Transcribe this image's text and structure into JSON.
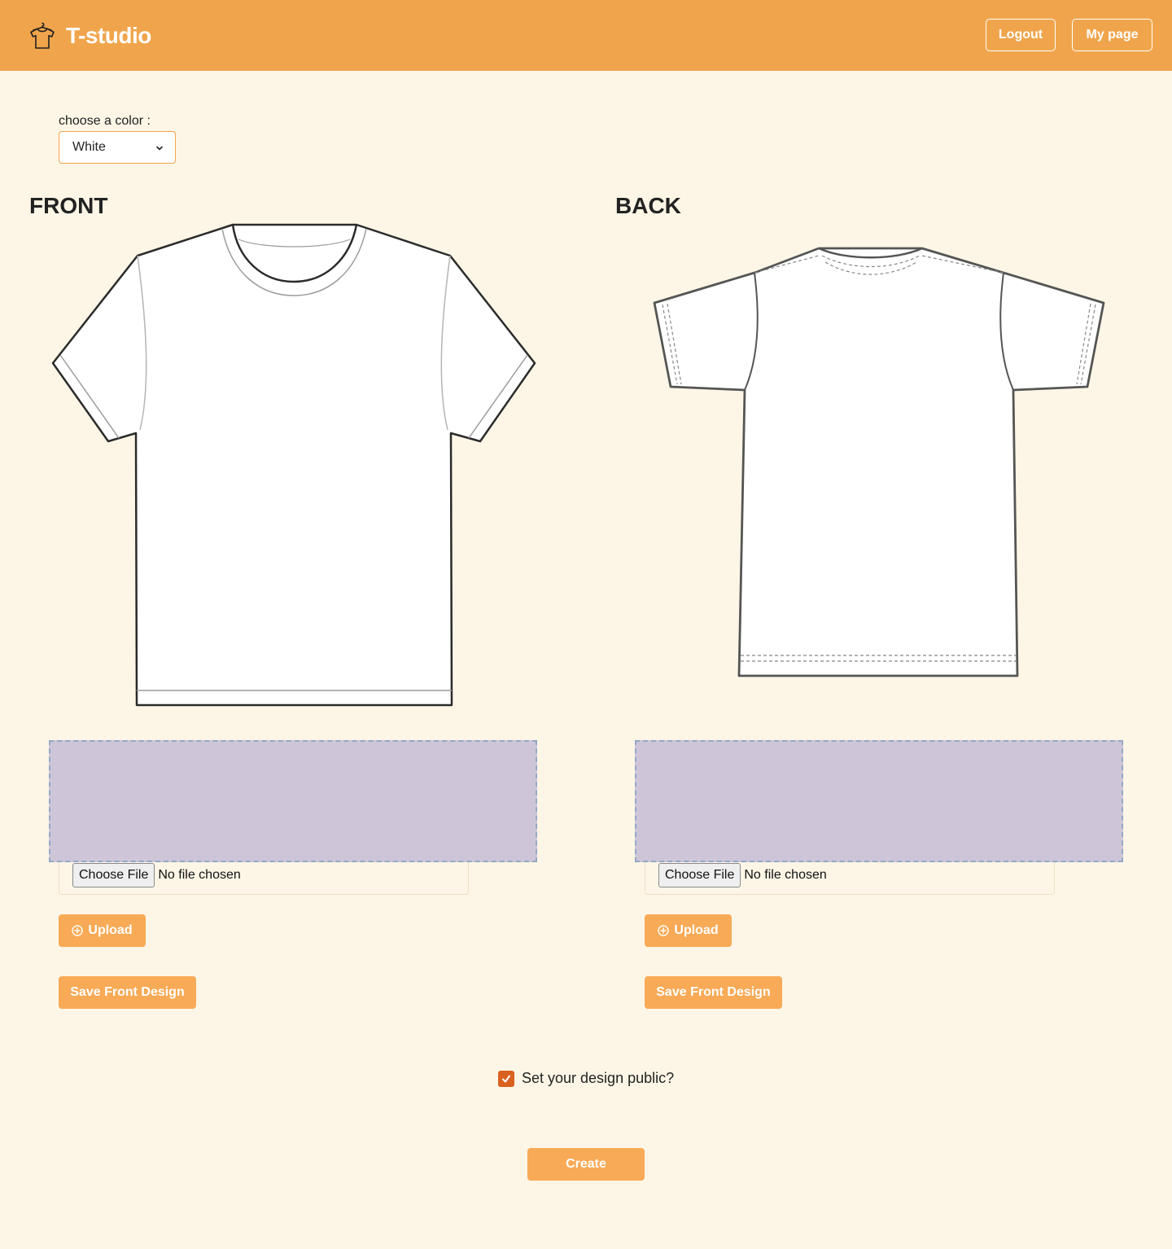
{
  "header": {
    "brand": "T-studio",
    "brand_icon": "tshirt-hanger-icon",
    "logout_label": "Logout",
    "mypage_label": "My page"
  },
  "color_picker": {
    "label": "choose a color :",
    "selected": "White",
    "icon": "chevron-down-icon"
  },
  "front": {
    "title": "FRONT",
    "file_button": "Choose File",
    "file_status": "No file chosen",
    "upload_label": "Upload",
    "upload_icon": "plus-circle-icon",
    "save_label": "Save Front Design"
  },
  "back": {
    "title": "BACK",
    "file_button": "Choose File",
    "file_status": "No file chosen",
    "upload_label": "Upload",
    "upload_icon": "plus-circle-icon",
    "save_label": "Save Front Design"
  },
  "public_option": {
    "label": "Set your design public?",
    "checked": true
  },
  "create_label": "Create",
  "colors": {
    "header": "#f0a54c",
    "background": "#fdf6e6",
    "button": "#f8aa56",
    "dropzone": "#cec6d8",
    "checkbox": "#d9611f"
  }
}
